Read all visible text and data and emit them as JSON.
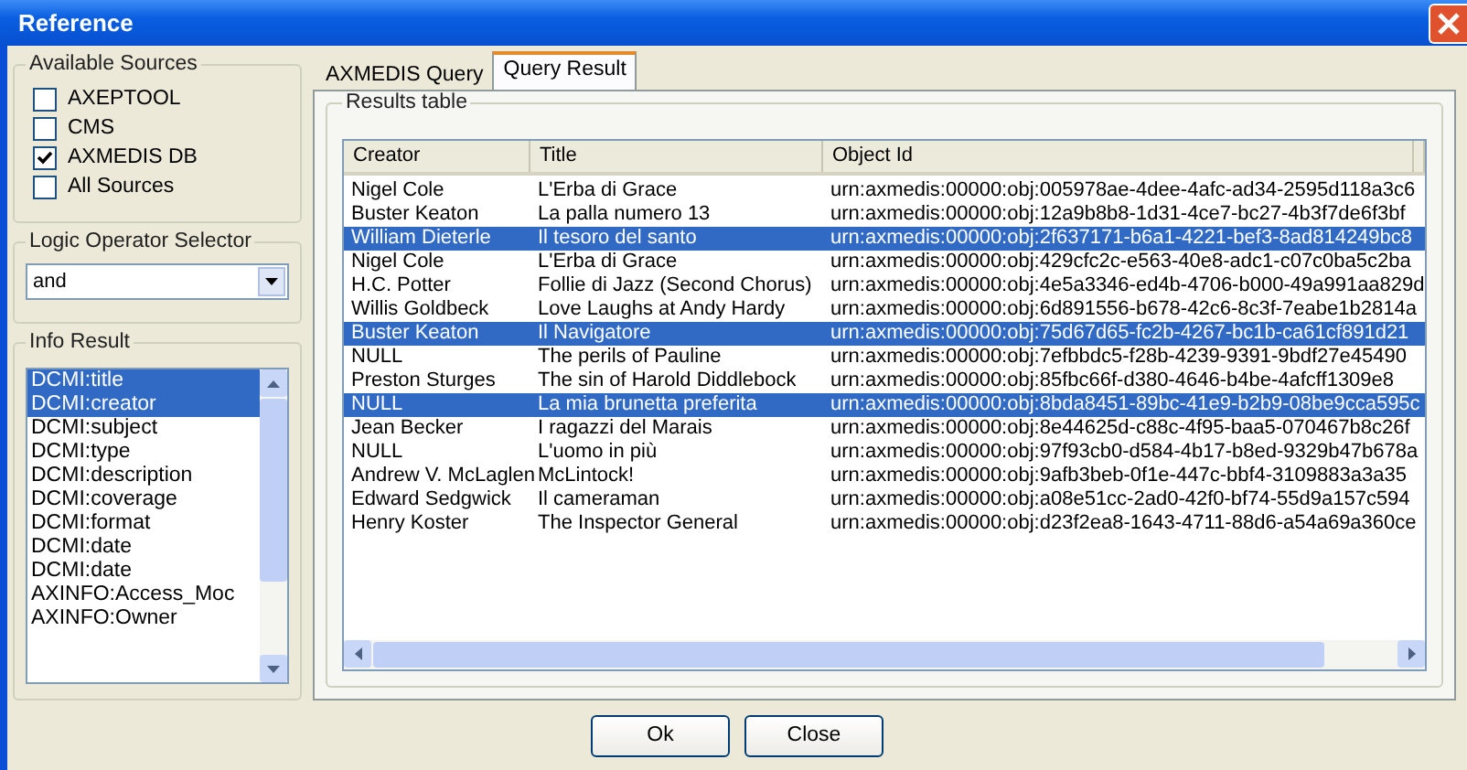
{
  "window": {
    "title": "Reference"
  },
  "available_sources": {
    "title": "Available Sources",
    "items": [
      {
        "label": "AXEPTOOL",
        "checked": false
      },
      {
        "label": "CMS",
        "checked": false
      },
      {
        "label": "AXMEDIS DB",
        "checked": true
      },
      {
        "label": "All Sources",
        "checked": false
      }
    ]
  },
  "logic_operator": {
    "title": "Logic Operator Selector",
    "value": "and"
  },
  "info_result": {
    "title": "Info Result",
    "items": [
      {
        "label": "DCMI:title",
        "selected": true
      },
      {
        "label": "DCMI:creator",
        "selected": true
      },
      {
        "label": "DCMI:subject",
        "selected": false
      },
      {
        "label": "DCMI:type",
        "selected": false
      },
      {
        "label": "DCMI:description",
        "selected": false
      },
      {
        "label": "DCMI:coverage",
        "selected": false
      },
      {
        "label": "DCMI:format",
        "selected": false
      },
      {
        "label": "DCMI:date",
        "selected": false
      },
      {
        "label": "DCMI:date",
        "selected": false
      },
      {
        "label": "AXINFO:Access_Moc",
        "selected": false
      },
      {
        "label": "AXINFO:Owner",
        "selected": false
      }
    ]
  },
  "tabs": [
    {
      "label": "AXMEDIS Query",
      "selected": false
    },
    {
      "label": "Query Result",
      "selected": true
    }
  ],
  "results": {
    "title": "Results table",
    "columns": [
      "Creator",
      "Title",
      "Object Id"
    ],
    "rows": [
      {
        "cells": [
          "Nigel Cole",
          "L'Erba di Grace",
          "urn:axmedis:00000:obj:005978ae-4dee-4afc-ad34-2595d118a3c6"
        ],
        "selected": false
      },
      {
        "cells": [
          "Buster Keaton",
          "La palla numero 13",
          "urn:axmedis:00000:obj:12a9b8b8-1d31-4ce7-bc27-4b3f7de6f3bf"
        ],
        "selected": false
      },
      {
        "cells": [
          "William Dieterle",
          "Il tesoro del santo",
          "urn:axmedis:00000:obj:2f637171-b6a1-4221-bef3-8ad814249bc8"
        ],
        "selected": true
      },
      {
        "cells": [
          "Nigel Cole",
          "L'Erba di Grace",
          "urn:axmedis:00000:obj:429cfc2c-e563-40e8-adc1-c07c0ba5c2ba"
        ],
        "selected": false
      },
      {
        "cells": [
          "H.C. Potter",
          "Follie di Jazz (Second Chorus)",
          "urn:axmedis:00000:obj:4e5a3346-ed4b-4706-b000-49a991aa829d"
        ],
        "selected": false
      },
      {
        "cells": [
          "Willis Goldbeck",
          "Love Laughs at Andy Hardy",
          "urn:axmedis:00000:obj:6d891556-b678-42c6-8c3f-7eabe1b2814a"
        ],
        "selected": false
      },
      {
        "cells": [
          "Buster Keaton",
          "Il Navigatore",
          "urn:axmedis:00000:obj:75d67d65-fc2b-4267-bc1b-ca61cf891d21"
        ],
        "selected": true
      },
      {
        "cells": [
          "NULL",
          "The perils of Pauline",
          "urn:axmedis:00000:obj:7efbbdc5-f28b-4239-9391-9bdf27e45490"
        ],
        "selected": false
      },
      {
        "cells": [
          "Preston Sturges",
          "The sin of Harold Diddlebock",
          "urn:axmedis:00000:obj:85fbc66f-d380-4646-b4be-4afcff1309e8"
        ],
        "selected": false
      },
      {
        "cells": [
          "NULL",
          "La mia brunetta preferita",
          "urn:axmedis:00000:obj:8bda8451-89bc-41e9-b2b9-08be9cca595c"
        ],
        "selected": true
      },
      {
        "cells": [
          "Jean Becker",
          "I ragazzi del Marais",
          "urn:axmedis:00000:obj:8e44625d-c88c-4f95-baa5-070467b8c26f"
        ],
        "selected": false
      },
      {
        "cells": [
          "NULL",
          "L'uomo in più",
          "urn:axmedis:00000:obj:97f93cb0-d584-4b17-b8ed-9329b47b678a"
        ],
        "selected": false
      },
      {
        "cells": [
          "Andrew V. McLaglen",
          "McLintock!",
          "urn:axmedis:00000:obj:9afb3beb-0f1e-447c-bbf4-3109883a3a35"
        ],
        "selected": false
      },
      {
        "cells": [
          "Edward Sedgwick",
          "Il cameraman",
          "urn:axmedis:00000:obj:a08e51cc-2ad0-42f0-bf74-55d9a157c594"
        ],
        "selected": false
      },
      {
        "cells": [
          "Henry Koster",
          "The Inspector General",
          "urn:axmedis:00000:obj:d23f2ea8-1643-4711-88d6-a54a69a360ce"
        ],
        "selected": false
      }
    ]
  },
  "buttons": [
    "Ok",
    "Close"
  ]
}
